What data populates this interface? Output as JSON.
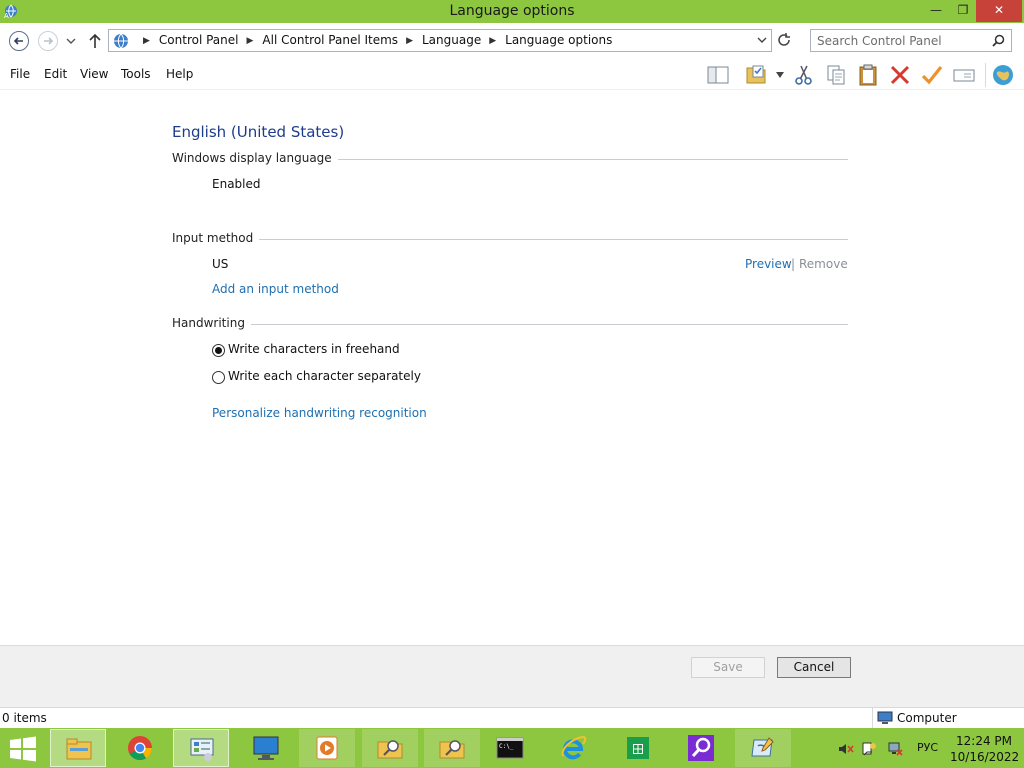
{
  "window": {
    "title": "Language options",
    "controls": {
      "minimize": "—",
      "maximize": "❐",
      "close": "✕"
    }
  },
  "address": {
    "breadcrumbs": [
      "Control Panel",
      "All Control Panel Items",
      "Language",
      "Language options"
    ],
    "search_placeholder": "Search Control Panel"
  },
  "menu": [
    "File",
    "Edit",
    "View",
    "Tools",
    "Help"
  ],
  "toolbar_icons": [
    "preview-pane-icon",
    "properties-icon",
    "cut-icon",
    "copy-icon",
    "paste-icon",
    "delete-icon",
    "checkmark-icon",
    "rename-icon",
    "internet-globe-icon"
  ],
  "main": {
    "title": "English (United States)",
    "display_language": {
      "heading": "Windows display language",
      "status": "Enabled"
    },
    "input_method": {
      "heading": "Input method",
      "method": "US",
      "preview_label": "Preview",
      "separator": "|",
      "remove_label": "Remove",
      "add_label": "Add an input method"
    },
    "handwriting": {
      "heading": "Handwriting",
      "options": [
        {
          "label": "Write characters in freehand",
          "selected": true
        },
        {
          "label": "Write each character separately",
          "selected": false
        }
      ],
      "personalize_label": "Personalize handwriting recognition"
    }
  },
  "footer": {
    "save_label": "Save",
    "save_enabled": false,
    "cancel_label": "Cancel"
  },
  "statusbar": {
    "items_text": "0 items",
    "location": "Computer"
  },
  "taskbar": {
    "apps": [
      "file-explorer-icon",
      "chrome-icon",
      "control-panel-icon",
      "computer-monitor-icon",
      "media-player-icon",
      "search-folder-icon",
      "search-folder-icon",
      "command-prompt-icon",
      "internet-explorer-icon",
      "store-icon",
      "search-app-icon",
      "windows-journal-icon"
    ],
    "language": "РУС",
    "time": "12:24 PM",
    "date": "10/16/2022"
  },
  "colors": {
    "accent_green": "#8dc63f",
    "close_red": "#c7433a",
    "title_blue": "#1e3c8c",
    "link_blue": "#1f6fb0"
  }
}
